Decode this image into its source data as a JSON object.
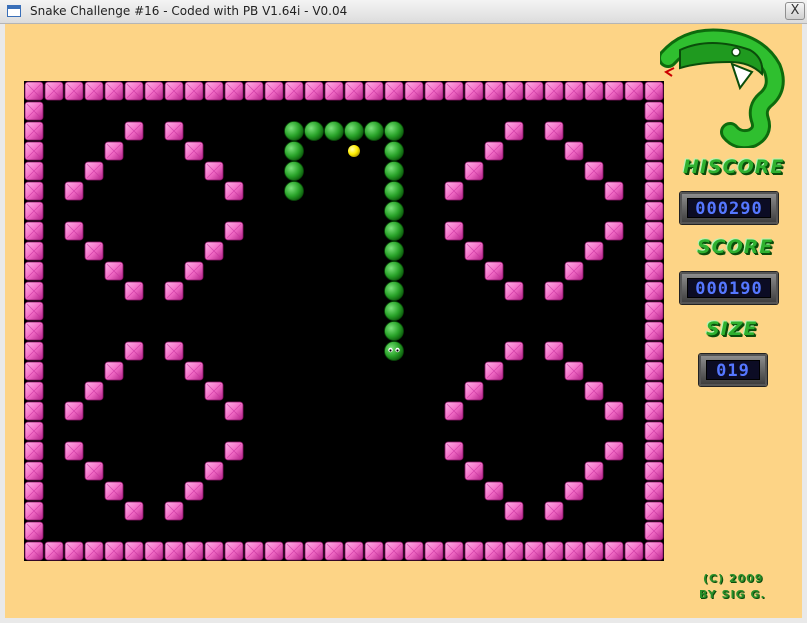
{
  "window": {
    "title": "Snake Challenge #16 - Coded with PB V1.64i - V0.04",
    "close_label": "X"
  },
  "colors": {
    "background": "#fdd486",
    "board": "#000000",
    "wall": "#f46fc8",
    "snake": "#29a329",
    "food": "#ffee00",
    "lcd_digits": "#5577ff"
  },
  "hud": {
    "hiscore_label": "HISCORE",
    "hiscore_value": "000290",
    "score_label": "SCORE",
    "score_value": "000190",
    "size_label": "SIZE",
    "size_value": "019"
  },
  "credits": {
    "line1": "(C) 2009",
    "line2": "BY SIG G."
  },
  "game": {
    "grid_cols": 32,
    "grid_rows": 24,
    "walls": [
      [
        5,
        2
      ],
      [
        7,
        2
      ],
      [
        4,
        3
      ],
      [
        8,
        3
      ],
      [
        3,
        4
      ],
      [
        9,
        4
      ],
      [
        2,
        5
      ],
      [
        10,
        5
      ],
      [
        2,
        7
      ],
      [
        10,
        7
      ],
      [
        3,
        8
      ],
      [
        9,
        8
      ],
      [
        4,
        9
      ],
      [
        8,
        9
      ],
      [
        5,
        10
      ],
      [
        7,
        10
      ],
      [
        24,
        2
      ],
      [
        26,
        2
      ],
      [
        23,
        3
      ],
      [
        27,
        3
      ],
      [
        22,
        4
      ],
      [
        28,
        4
      ],
      [
        21,
        5
      ],
      [
        29,
        5
      ],
      [
        21,
        7
      ],
      [
        29,
        7
      ],
      [
        22,
        8
      ],
      [
        28,
        8
      ],
      [
        23,
        9
      ],
      [
        27,
        9
      ],
      [
        24,
        10
      ],
      [
        26,
        10
      ],
      [
        5,
        13
      ],
      [
        7,
        13
      ],
      [
        4,
        14
      ],
      [
        8,
        14
      ],
      [
        3,
        15
      ],
      [
        9,
        15
      ],
      [
        2,
        16
      ],
      [
        10,
        16
      ],
      [
        2,
        18
      ],
      [
        10,
        18
      ],
      [
        3,
        19
      ],
      [
        9,
        19
      ],
      [
        4,
        20
      ],
      [
        8,
        20
      ],
      [
        5,
        21
      ],
      [
        7,
        21
      ],
      [
        24,
        13
      ],
      [
        26,
        13
      ],
      [
        23,
        14
      ],
      [
        27,
        14
      ],
      [
        22,
        15
      ],
      [
        28,
        15
      ],
      [
        21,
        16
      ],
      [
        29,
        16
      ],
      [
        21,
        18
      ],
      [
        29,
        18
      ],
      [
        22,
        19
      ],
      [
        28,
        19
      ],
      [
        23,
        20
      ],
      [
        27,
        20
      ],
      [
        24,
        21
      ],
      [
        26,
        21
      ]
    ],
    "snake": [
      [
        18,
        13
      ],
      [
        18,
        12
      ],
      [
        18,
        11
      ],
      [
        18,
        10
      ],
      [
        18,
        9
      ],
      [
        18,
        8
      ],
      [
        18,
        7
      ],
      [
        18,
        6
      ],
      [
        18,
        5
      ],
      [
        18,
        4
      ],
      [
        18,
        3
      ],
      [
        18,
        2
      ],
      [
        17,
        2
      ],
      [
        16,
        2
      ],
      [
        15,
        2
      ],
      [
        14,
        2
      ],
      [
        13,
        2
      ],
      [
        13,
        3
      ],
      [
        13,
        4
      ],
      [
        13,
        5
      ]
    ],
    "food": [
      16,
      3
    ]
  }
}
